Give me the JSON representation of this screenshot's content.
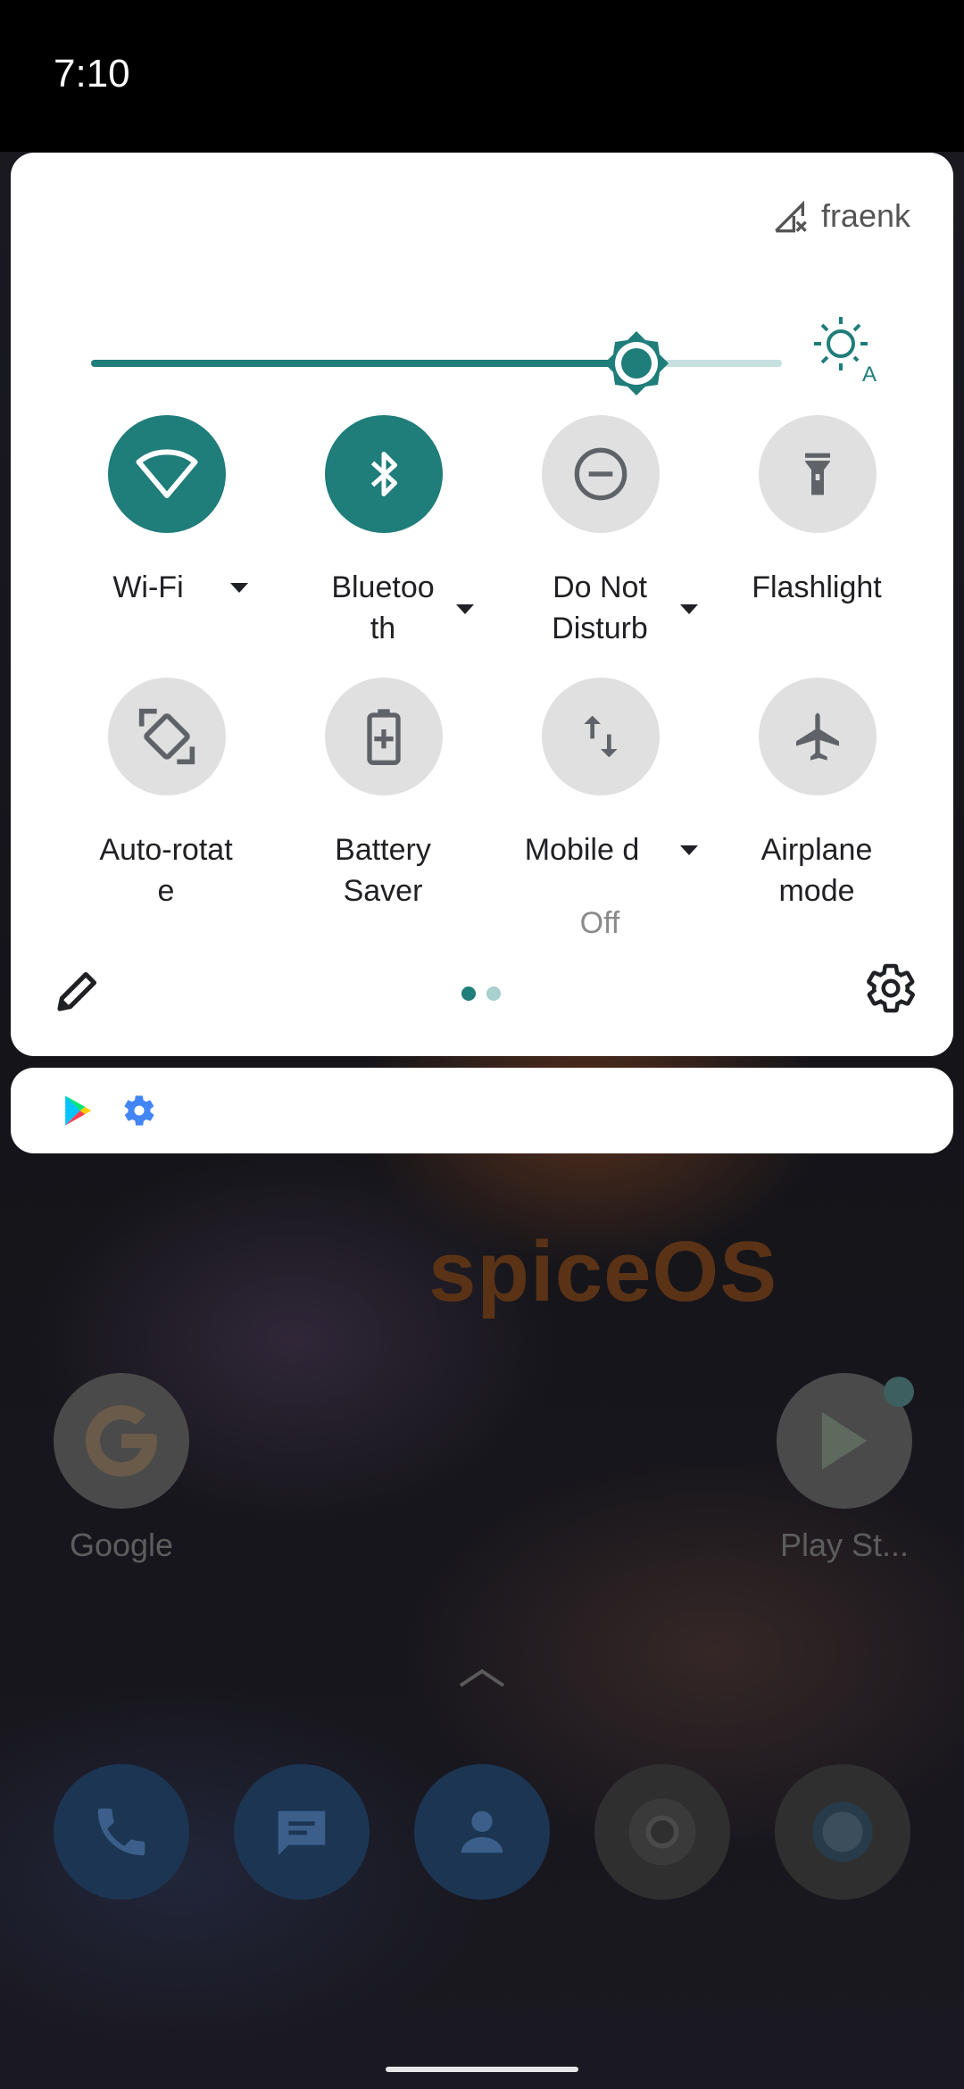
{
  "status_bar": {
    "time": "7:10"
  },
  "quick_settings": {
    "carrier": "fraenk",
    "brightness_level": 0.79,
    "tiles": [
      {
        "id": "wifi",
        "label": "Wi-Fi",
        "state": "on",
        "icon": "wifi-icon",
        "has_dropdown": true
      },
      {
        "id": "bluetooth",
        "label": "Bluetoo\nth",
        "state": "on",
        "icon": "bluetooth-icon",
        "has_dropdown": true
      },
      {
        "id": "dnd",
        "label": "Do Not\nDisturb",
        "state": "off",
        "icon": "do-not-disturb-icon",
        "has_dropdown": true
      },
      {
        "id": "flashlight",
        "label": "Flashlight",
        "state": "off",
        "icon": "flashlight-icon",
        "has_dropdown": false
      },
      {
        "id": "autorotate",
        "label": "Auto-rotat\ne",
        "state": "off",
        "icon": "auto-rotate-icon",
        "has_dropdown": false
      },
      {
        "id": "battery",
        "label": "Battery\nSaver",
        "state": "off",
        "icon": "battery-saver-icon",
        "has_dropdown": false
      },
      {
        "id": "mobile",
        "label": "Mobile d",
        "secondary": "Off",
        "state": "off",
        "icon": "mobile-data-icon",
        "has_dropdown": true
      },
      {
        "id": "airplane",
        "label": "Airplane\nmode",
        "state": "off",
        "icon": "airplane-icon",
        "has_dropdown": false
      }
    ],
    "pages": {
      "total": 2,
      "current": 1
    }
  },
  "notifications": {
    "icons": [
      "play-store-icon",
      "settings-gear-icon"
    ]
  },
  "home": {
    "logo_text": "spiceOS",
    "apps": [
      {
        "name": "Google",
        "icon": "google-icon"
      },
      {
        "name": "Play St...",
        "icon": "play-store-icon"
      }
    ],
    "dock": [
      "phone-icon",
      "messages-icon",
      "contacts-icon",
      "chrome-icon",
      "camera-icon"
    ]
  },
  "colors": {
    "accent": "#1f7d7a",
    "accent_light": "#a7d0ce",
    "tile_off": "#e0e0e0",
    "panel": "#ffffff"
  }
}
